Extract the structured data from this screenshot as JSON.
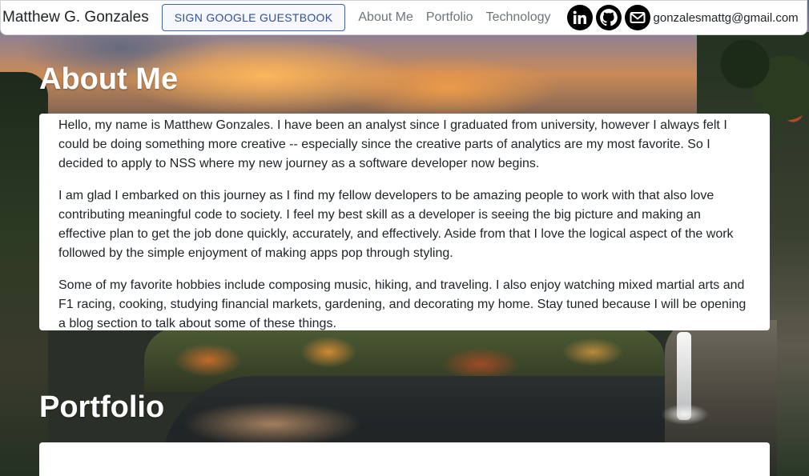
{
  "navbar": {
    "brand": "Matthew G. Gonzales",
    "guestbook_button": "SIGN GOOGLE GUESTBOOK",
    "links": [
      "About Me",
      "Portfolio",
      "Technology"
    ],
    "social_icons": [
      "linkedin-icon",
      "github-icon",
      "email-icon"
    ],
    "email": "gonzalesmattg@gmail.com"
  },
  "about": {
    "title": "About Me",
    "paragraphs": [
      "Hello, my name is Matthew Gonzales. I have been an analyst since I graduated from university, however I always felt I could be doing something more creative -- especially since the creative parts of analytics are my most favorite. So I decided to apply to NSS where my new journey as a software developer now begins.",
      "I am glad I embarked on this journey as I find my fellow developers to be amazing people to work with that also love contributing meaningful code to society. I feel my best skill as a developer is seeing the big picture and making an effective plan to get the job done quickly, accurately, and effectively. Aside from that I love the logical aspect of the work followed by the simple enjoyment of making apps pop through styling.",
      "Some of my favorite hobbies include composing music, hiking, and traveling. I also enjoy watching mixed martial arts and F1 racing, cooking, studying financial markets, gardening, and decorating my home. Stay tuned because I will be opening a blog section to talk about some of these things."
    ]
  },
  "portfolio": {
    "title": "Portfolio"
  },
  "colors": {
    "button_border": "#3e62b3",
    "button_text": "#2f4ea3",
    "nav_link": "#6c757d",
    "card_background": "#ffffff"
  }
}
